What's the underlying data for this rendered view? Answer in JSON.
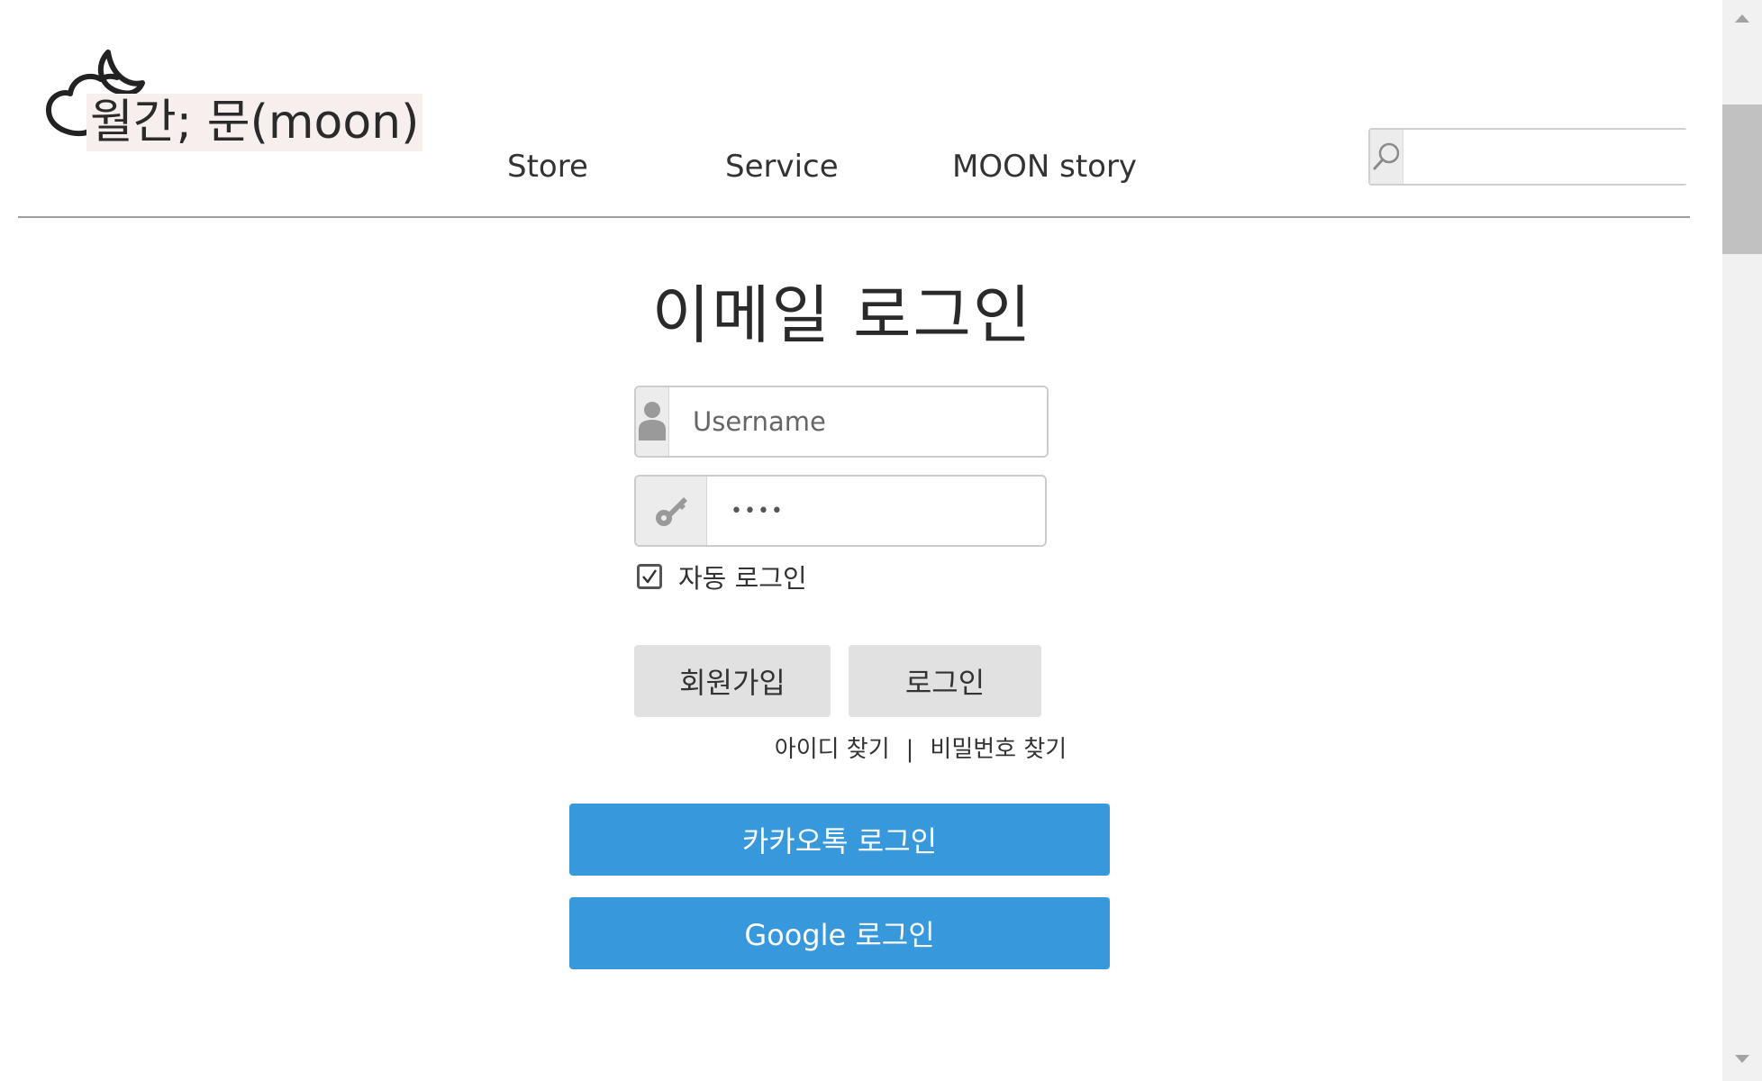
{
  "header": {
    "logo_text": "월간; 문(moon)",
    "nav": [
      "Store",
      "Service",
      "MOON story"
    ],
    "search": {
      "icon": "search-icon",
      "value": ""
    }
  },
  "login": {
    "title": "이메일 로그인",
    "username": {
      "icon": "user-icon",
      "placeholder": "Username",
      "value": ""
    },
    "password": {
      "icon": "key-icon",
      "value": "••••"
    },
    "remember": {
      "label": "자동 로그인",
      "checked": true
    },
    "signup_label": "회원가입",
    "login_label": "로그인",
    "find_id_label": "아이디 찾기",
    "find_separator": "|",
    "find_password_label": "비밀번호 찾기",
    "kakao_label": "카카오톡 로그인",
    "google_label": "Google 로그인"
  },
  "colors": {
    "primary_button": "#3799db",
    "secondary_button": "#e1e1e1",
    "divider": "#9e9e9e"
  }
}
